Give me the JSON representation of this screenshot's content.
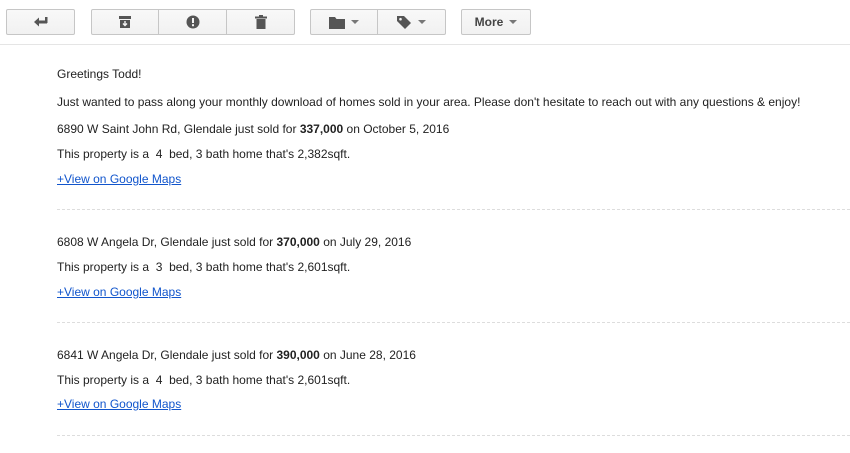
{
  "toolbar": {
    "back_icon": "reply-arrow-icon",
    "archive_icon": "archive-icon",
    "spam_icon": "report-spam-icon",
    "delete_icon": "trash-icon",
    "move_icon": "folder-icon",
    "labels_icon": "label-tag-icon",
    "more_label": "More"
  },
  "email": {
    "greeting": "Greetings Todd!",
    "intro": "Just wanted to pass along your monthly download of homes sold in your area. Please don't hesitate to reach out with any questions & enjoy!",
    "listings": [
      {
        "sold_prefix": "6890 W Saint John Rd, Glendale just sold for ",
        "price": "337,000",
        "sold_suffix": " on October 5, 2016",
        "prop_prefix": "This property is a ",
        "beds": "4",
        "prop_suffix": " bed, 3 bath home that's 2,382sqft.",
        "map_link": "+View on Google Maps"
      },
      {
        "sold_prefix": "6808 W Angela Dr, Glendale just sold for ",
        "price": "370,000",
        "sold_suffix": " on July 29, 2016",
        "prop_prefix": "This property is a ",
        "beds": "3",
        "prop_suffix": " bed, 3 bath home that's 2,601sqft.",
        "map_link": "+View on Google Maps"
      },
      {
        "sold_prefix": "6841 W Angela Dr, Glendale just sold for ",
        "price": "390,000",
        "sold_suffix": " on June 28, 2016",
        "prop_prefix": "This property is a ",
        "beds": "4",
        "prop_suffix": " bed, 3 bath home that's 2,601sqft.",
        "map_link": "+View on Google Maps"
      }
    ]
  }
}
